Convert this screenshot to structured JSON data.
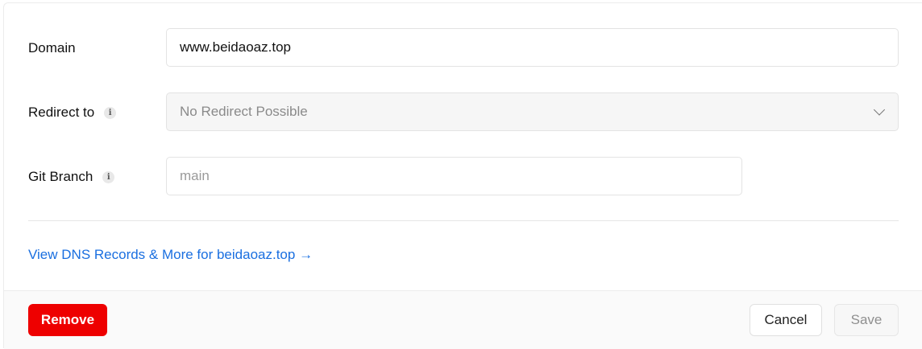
{
  "form": {
    "domain": {
      "label": "Domain",
      "value": "www.beidaoaz.top"
    },
    "redirect": {
      "label": "Redirect to",
      "value": "No Redirect Possible",
      "icon": "info-icon"
    },
    "git_branch": {
      "label": "Git Branch",
      "placeholder": "main",
      "icon": "info-icon"
    }
  },
  "dns_link": "View DNS Records & More for beidaoaz.top →",
  "footer": {
    "remove_label": "Remove",
    "cancel_label": "Cancel",
    "save_label": "Save"
  },
  "colors": {
    "danger": "#ee0000",
    "link": "#1a6fe0"
  }
}
